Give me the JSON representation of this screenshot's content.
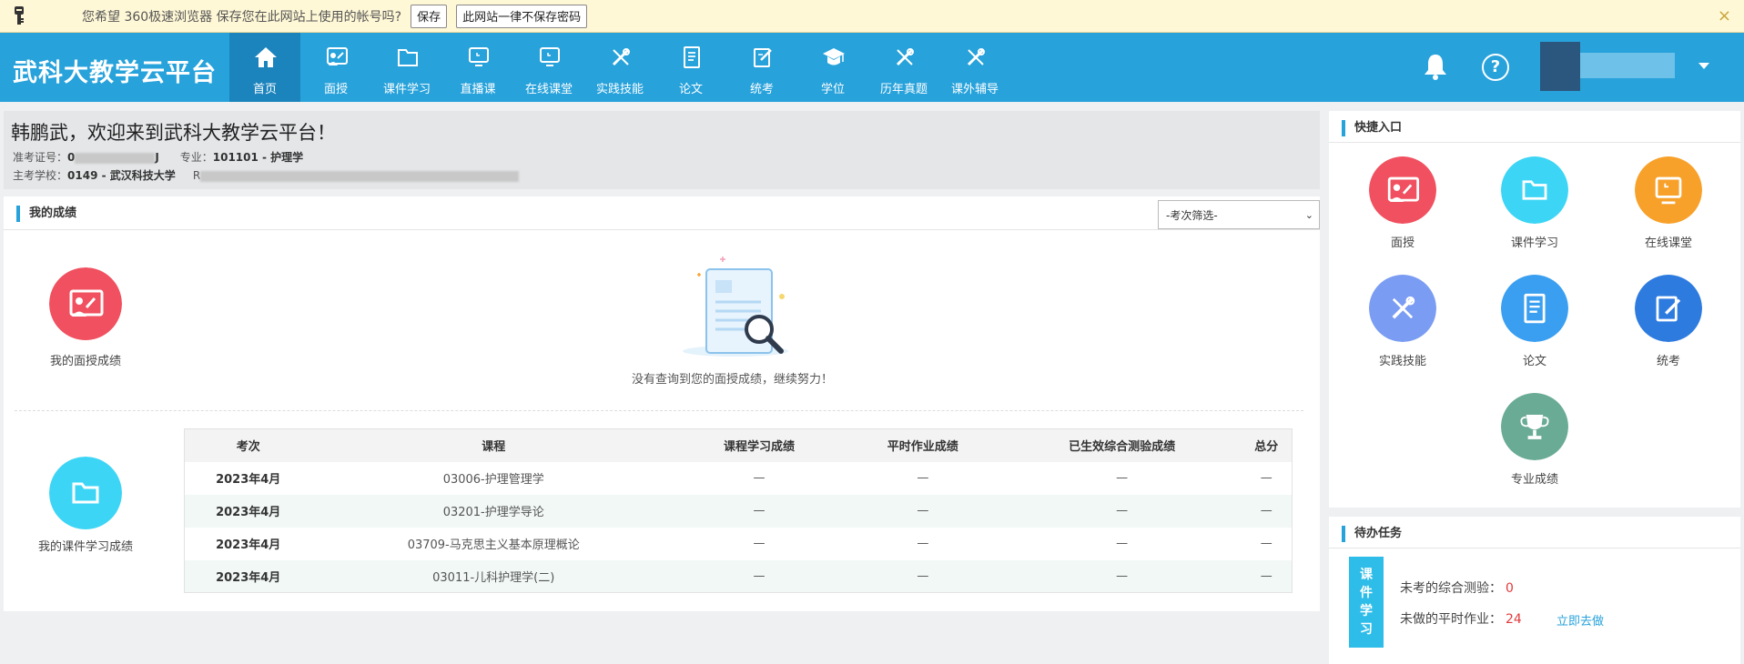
{
  "password_bar": {
    "message": "您希望 360极速浏览器 保存您在此网站上使用的帐号吗?",
    "save_label": "保存",
    "never_label": "此网站一律不保存密码",
    "close_glyph": "×"
  },
  "header": {
    "brand": "武科大教学云平台",
    "nav": [
      {
        "label": "首页",
        "icon": "home-icon"
      },
      {
        "label": "面授",
        "icon": "teacher-board-icon"
      },
      {
        "label": "课件学习",
        "icon": "folder-icon"
      },
      {
        "label": "直播课",
        "icon": "monitor-icon"
      },
      {
        "label": "在线课堂",
        "icon": "monitor-icon"
      },
      {
        "label": "实践技能",
        "icon": "tools-icon"
      },
      {
        "label": "论文",
        "icon": "document-icon"
      },
      {
        "label": "统考",
        "icon": "edit-icon"
      },
      {
        "label": "学位",
        "icon": "graduation-cap-icon"
      },
      {
        "label": "历年真题",
        "icon": "tools-icon"
      },
      {
        "label": "课外辅导",
        "icon": "tools-icon"
      }
    ],
    "help_glyph": "?"
  },
  "welcome": {
    "title": "韩鹏武，欢迎来到武科大教学云平台！",
    "exam_no_label": "准考证号：",
    "exam_no_start": "0",
    "exam_no_end": "J",
    "major_label": "专业：",
    "major_value": "101101 - 护理学",
    "school_label": "主考学校：",
    "school_value": "0149 - 武汉科技大学",
    "other_label": "R"
  },
  "scores": {
    "section_title": "我的成绩",
    "filter_value": "-考次筛选-",
    "filter_caret": "⌄",
    "face_label": "我的面授成绩",
    "face_empty": "没有查询到您的面授成绩，继续努力！",
    "course_label": "我的课件学习成绩",
    "columns": [
      "考次",
      "课程",
      "课程学习成绩",
      "平时作业成绩",
      "已生效综合测验成绩",
      "总分"
    ],
    "rows": [
      {
        "date": "2023年4月",
        "course": "03006-护理管理学",
        "study": "—",
        "homework": "—",
        "quiz": "—",
        "total": "—"
      },
      {
        "date": "2023年4月",
        "course": "03201-护理学导论",
        "study": "—",
        "homework": "—",
        "quiz": "—",
        "total": "—"
      },
      {
        "date": "2023年4月",
        "course": "03709-马克思主义基本原理概论",
        "study": "—",
        "homework": "—",
        "quiz": "—",
        "total": "—"
      },
      {
        "date": "2023年4月",
        "course": "03011-儿科护理学(二)",
        "study": "—",
        "homework": "—",
        "quiz": "—",
        "total": "—"
      }
    ]
  },
  "quick_entry": {
    "title": "快捷入口",
    "items": [
      {
        "label": "面授",
        "color": "#f0505f",
        "icon": "teacher-board-icon"
      },
      {
        "label": "课件学习",
        "color": "#3dd5f5",
        "icon": "folder-icon"
      },
      {
        "label": "在线课堂",
        "color": "#f7a12a",
        "icon": "monitor-icon"
      },
      {
        "label": "实践技能",
        "color": "#7a9cf2",
        "icon": "tools-icon"
      },
      {
        "label": "论文",
        "color": "#3a9ff0",
        "icon": "document-icon"
      },
      {
        "label": "统考",
        "color": "#2e7be0",
        "icon": "edit-icon"
      },
      {
        "label": "专业成绩",
        "color": "#6aab96",
        "icon": "trophy-icon"
      }
    ]
  },
  "todo": {
    "title": "待办任务",
    "tag_chars": [
      "课",
      "件",
      "学",
      "习"
    ],
    "quiz_label": "未考的综合测验：",
    "quiz_count": "0",
    "homework_label": "未做的平时作业：",
    "homework_count": "24",
    "go_label": "立即去做"
  },
  "colors": {
    "nav_bg": "#27a2db",
    "nav_active": "#1c84bd",
    "accent": "#27a2db",
    "alert": "#e4393c"
  }
}
